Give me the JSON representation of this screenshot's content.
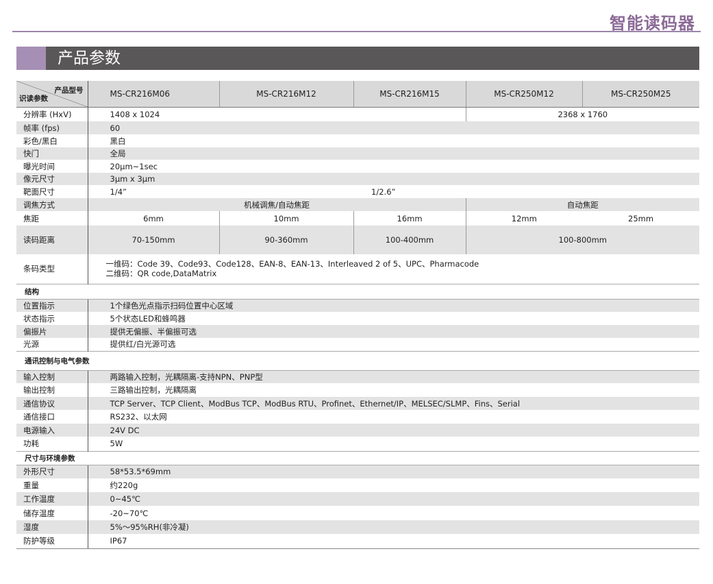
{
  "header": {
    "brand": "智能读码器",
    "section_title": "产品参数"
  },
  "table": {
    "corner_top": "产品型号",
    "corner_bottom": "识读参数",
    "models": [
      "MS-CR216M06",
      "MS-CR216M12",
      "MS-CR216M15",
      "MS-CR250M12",
      "MS-CR250M25"
    ],
    "resolution": {
      "label": "分辨率 (HxV)",
      "v1": "1408 x 1024",
      "v2": "2368 x 1760"
    },
    "framerate": {
      "label": "帧率 (fps)",
      "value": "60"
    },
    "color": {
      "label": "彩色/黑白",
      "value": "黑白"
    },
    "shutter": {
      "label": "快门",
      "value": "全局"
    },
    "exposure": {
      "label": "曝光时间",
      "value": "20μm~1sec"
    },
    "pixel": {
      "label": "像元尺寸",
      "value": "3μm x 3μm"
    },
    "target": {
      "label": "靶面尺寸",
      "v1": "1/4”",
      "v2": "1/2.6”"
    },
    "focus_mode": {
      "label": "调焦方式",
      "v1": "机械调焦/自动焦距",
      "v2": "自动焦距"
    },
    "focal": {
      "label": "焦距",
      "values": [
        "6mm",
        "10mm",
        "16mm",
        "12mm",
        "25mm"
      ]
    },
    "distance": {
      "label": "读码距离",
      "values": [
        "70-150mm",
        "90-360mm",
        "100-400mm",
        "100-800mm"
      ]
    },
    "barcode": {
      "label": "条码类型",
      "line1": "一维码：Code 39、Code93、Code128、EAN-8、EAN-13、Interleaved 2 of 5、UPC、Pharmacode",
      "line2": "二维码：QR code,DataMatrix"
    },
    "structure": {
      "title": "结构",
      "rows": [
        {
          "label": "位置指示",
          "value": "1个绿色光点指示扫码位置中心区域"
        },
        {
          "label": "状态指示",
          "value": "5个状态LED和蜂鸣器"
        },
        {
          "label": "偏振片",
          "value": "提供无偏振、半偏振可选"
        },
        {
          "label": "光源",
          "value": "提供红/白光源可选"
        }
      ]
    },
    "comm": {
      "title": "通讯控制与电气参数",
      "rows": [
        {
          "label": "输入控制",
          "value": "两路输入控制，光耦隔离-支持NPN、PNP型"
        },
        {
          "label": "输出控制",
          "value": "三路输出控制，光耦隔离"
        },
        {
          "label": "通信协议",
          "value": "TCP Server、TCP Client、ModBus TCP、ModBus RTU、Profinet、Ethernet/IP、MELSEC/SLMP、Fins、Serial"
        },
        {
          "label": "通信接口",
          "value": "RS232、以太网"
        },
        {
          "label": "电源输入",
          "value": "24V DC"
        },
        {
          "label": "功耗",
          "value": "5W"
        }
      ]
    },
    "env": {
      "title": "尺寸与环境参数",
      "rows": [
        {
          "label": "外形尺寸",
          "value": "58*53.5*69mm"
        },
        {
          "label": "重量",
          "value": "约220g"
        },
        {
          "label": "工作温度",
          "value": "0~45℃"
        },
        {
          "label": "储存温度",
          "value": "-20~70℃"
        },
        {
          "label": "湿度",
          "value": "5%～95%RH(非冷凝)"
        },
        {
          "label": "防护等级",
          "value": "IP67"
        }
      ]
    }
  }
}
